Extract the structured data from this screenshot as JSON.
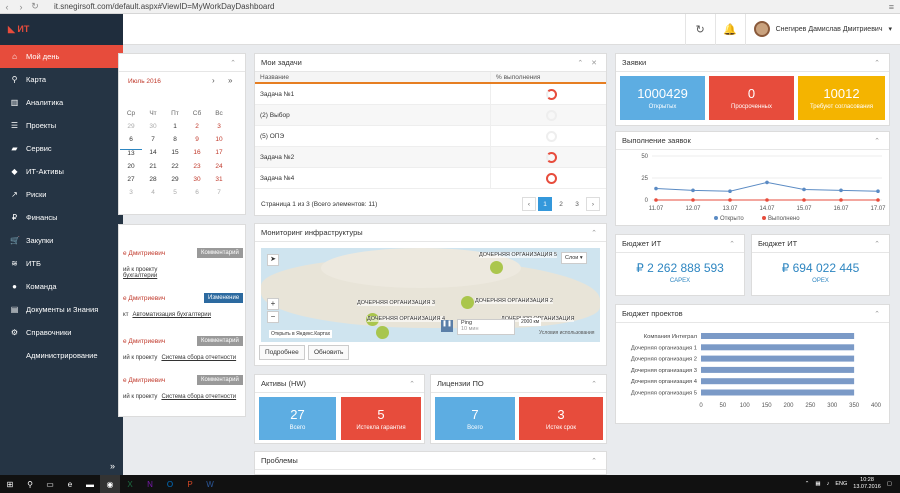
{
  "browser": {
    "url": "it.snegirsoft.com/default.aspx#ViewID=MyWorkDayDashboard"
  },
  "user": {
    "name": "Снегирев Дамислав Дмитриевич"
  },
  "sidebar": {
    "items": [
      {
        "label": "Мой день",
        "icon": "home-icon"
      },
      {
        "label": "Карта",
        "icon": "map-pin-icon"
      },
      {
        "label": "Аналитика",
        "icon": "bar-chart-icon"
      },
      {
        "label": "Проекты",
        "icon": "list-icon"
      },
      {
        "label": "Сервис",
        "icon": "truck-icon"
      },
      {
        "label": "ИТ-Активы",
        "icon": "car-icon"
      },
      {
        "label": "Риски",
        "icon": "chart-icon"
      },
      {
        "label": "Финансы",
        "icon": "ruble-icon"
      },
      {
        "label": "Закупки",
        "icon": "cart-icon"
      },
      {
        "label": "ИТБ",
        "icon": "wifi-icon"
      },
      {
        "label": "Команда",
        "icon": "team-icon"
      },
      {
        "label": "Документы и Знания",
        "icon": "folder-icon"
      },
      {
        "label": "Справочники",
        "icon": "gears-icon"
      },
      {
        "label": "Администрирование",
        "icon": ""
      }
    ]
  },
  "calendar": {
    "month": "Июль 2016",
    "weekdays": [
      "Ср",
      "Чт",
      "Пт",
      "Сб",
      "Вс"
    ],
    "rows": [
      [
        "29",
        "30",
        "1",
        "2",
        "3"
      ],
      [
        "6",
        "7",
        "8",
        "9",
        "10"
      ],
      [
        "13",
        "14",
        "15",
        "16",
        "17"
      ],
      [
        "20",
        "21",
        "22",
        "23",
        "24"
      ],
      [
        "27",
        "28",
        "29",
        "30",
        "31"
      ],
      [
        "3",
        "4",
        "5",
        "6",
        "7"
      ]
    ]
  },
  "activity": [
    {
      "who": "е Дмитриевич",
      "badge": "Комментарий",
      "l1": "ий к проекту",
      "link": "бухгалтерии"
    },
    {
      "who": "е Дмитриевич",
      "badge": "Изменение",
      "l1": "кт",
      "link": "Автоматизация бухгалтерии"
    },
    {
      "who": "е Дмитриевич",
      "badge": "Комментарий",
      "l1": "ий к проекту",
      "link": "Система сбора отчетности"
    },
    {
      "who": "е Дмитриевич",
      "badge": "Комментарий",
      "l1": "ий к проекту",
      "link": "Система сбора отчетности"
    }
  ],
  "tasks": {
    "title": "Мои задачи",
    "col_name": "Название",
    "col_pct": "% выполнения",
    "rows": [
      {
        "name": "Задача №1"
      },
      {
        "name": "(2) Выбор"
      },
      {
        "name": "(5) ОПЭ"
      },
      {
        "name": "Задача №2"
      },
      {
        "name": "Задача №4"
      }
    ],
    "pager_text": "Страница 1 из 3 (Всего элементов: 11)",
    "pages": [
      "1",
      "2",
      "3"
    ]
  },
  "monitoring": {
    "title": "Мониторинг инфраструктуры",
    "labels": [
      "ДОЧЕРНЯЯ ОРГАНИЗАЦИЯ 5",
      "ДОЧЕРНЯЯ ОРГАНИЗАЦИЯ 3",
      "ДОЧЕРНЯЯ ОРГАНИЗАЦИЯ 2",
      "ДОЧЕРНЯЯ ОРГАНИЗАЦИЯ 4",
      "ДОЧЕРНЯЯ ОРГАНИЗАЦИЯ"
    ],
    "layers": "Слои",
    "yandex": "Открыть в Яндекс.Картах",
    "ping": "Ping",
    "ping_sub": "10 мин",
    "scale": "2000 км",
    "terms": "Условия использования",
    "more": "Подробнее",
    "refresh": "Обновить"
  },
  "assets": {
    "title": "Активы (HW)",
    "total": "27",
    "total_l": "Всего",
    "warranty": "5",
    "warranty_l": "Истекла гарантия"
  },
  "licenses": {
    "title": "Лицензии ПО",
    "total": "7",
    "total_l": "Всего",
    "expired": "3",
    "expired_l": "Истек срок"
  },
  "problems": {
    "title": "Проблемы"
  },
  "requests": {
    "title": "Заявки",
    "open": "1000429",
    "open_l": "Открытых",
    "overdue": "0",
    "overdue_l": "Просроченных",
    "approval": "10012",
    "approval_l": "Требуют согласования"
  },
  "fulfillment": {
    "title": "Выполнение заявок",
    "legend": [
      "Открыто",
      "Выполнено"
    ]
  },
  "budget_capex": {
    "title": "Бюджет ИТ",
    "value": "₽ 2 262 888 593",
    "label": "CAPEX"
  },
  "budget_opex": {
    "title": "Бюджет ИТ",
    "value": "₽ 694 022 445",
    "label": "OPEX"
  },
  "projects_budget": {
    "title": "Бюджет проектов"
  },
  "taskbar": {
    "lang": "ENG",
    "time": "10:28",
    "date": "13.07.2016"
  },
  "colors": {
    "red": "#e74c3c",
    "blue": "#5dade2",
    "yellow": "#f4b400",
    "sidebar": "#253444"
  },
  "chart_data": [
    {
      "type": "line",
      "title": "Выполнение заявок",
      "categories": [
        "11.07",
        "12.07",
        "13.07",
        "14.07",
        "15.07",
        "16.07",
        "17.07"
      ],
      "ylim": [
        0,
        50
      ],
      "yticks": [
        "0",
        "25",
        "50"
      ],
      "series": [
        {
          "name": "Открыто",
          "values": [
            13,
            11,
            10,
            20,
            12,
            11,
            10
          ]
        },
        {
          "name": "Выполнено",
          "values": [
            0,
            0,
            0,
            0,
            0,
            0,
            0
          ]
        }
      ],
      "legend": "bottom"
    },
    {
      "type": "bar",
      "orientation": "horizontal",
      "title": "Бюджет проектов",
      "categories": [
        "Компания Интеграл",
        "Дочерняя организация 1",
        "Дочерняя организация 2",
        "Дочерняя организация 3",
        "Дочерняя организация 4",
        "Дочерняя организация 5"
      ],
      "values": [
        350,
        350,
        350,
        350,
        350,
        350
      ],
      "xlim": [
        0,
        400
      ],
      "xticks": [
        "0",
        "50",
        "100",
        "150",
        "200",
        "250",
        "300",
        "350",
        "400"
      ]
    }
  ]
}
